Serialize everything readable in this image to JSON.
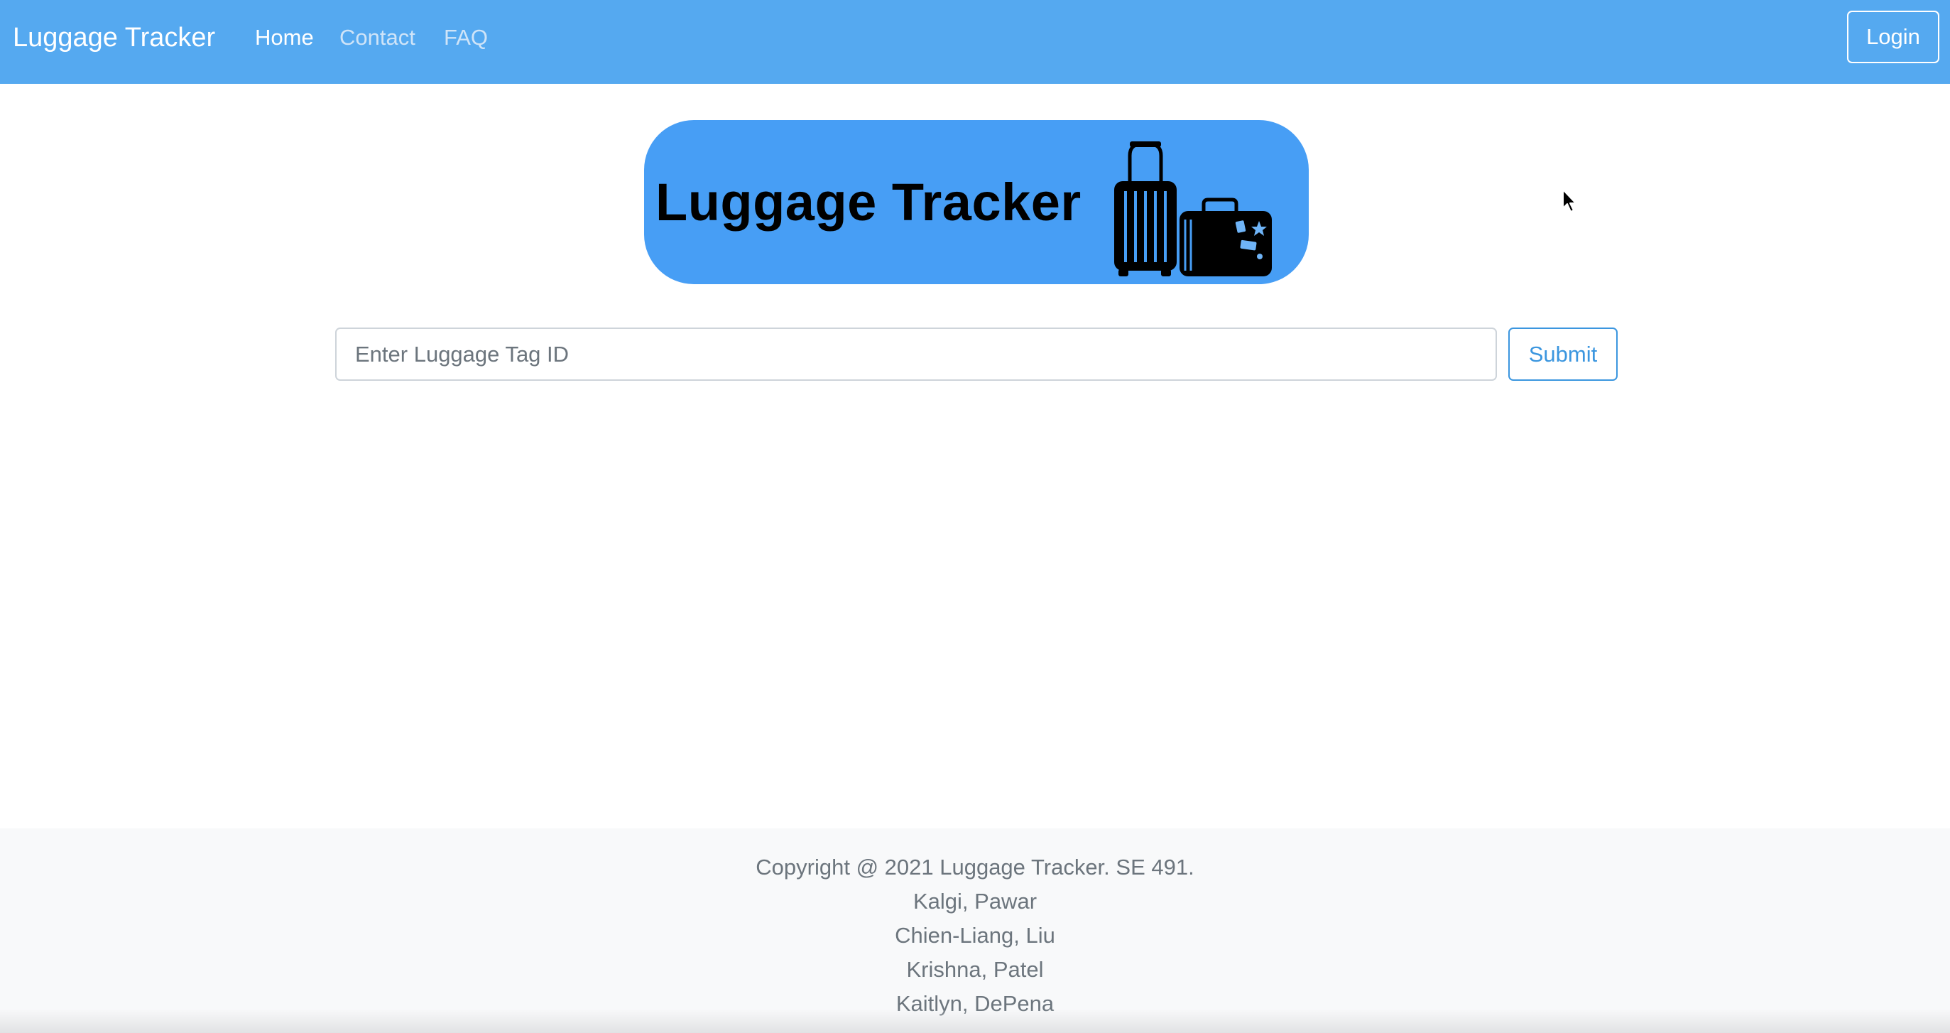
{
  "navbar": {
    "brand": "Luggage Tracker",
    "links": [
      {
        "label": "Home",
        "active": true
      },
      {
        "label": "Contact",
        "active": false
      },
      {
        "label": "FAQ",
        "active": false
      }
    ],
    "login_label": "Login",
    "background_color": "#55a9f0"
  },
  "logo": {
    "text": "Luggage Tracker",
    "icon": "luggage-icon",
    "background_color": "#479ef5"
  },
  "search": {
    "placeholder": "Enter Luggage Tag ID",
    "value": "",
    "submit_label": "Submit"
  },
  "footer": {
    "copyright": "Copyright @ 2021 Luggage Tracker. SE 491.",
    "authors": [
      "Kalgi, Pawar",
      "Chien-Liang, Liu",
      "Krishna, Patel",
      "Kaitlyn, DePena"
    ]
  }
}
